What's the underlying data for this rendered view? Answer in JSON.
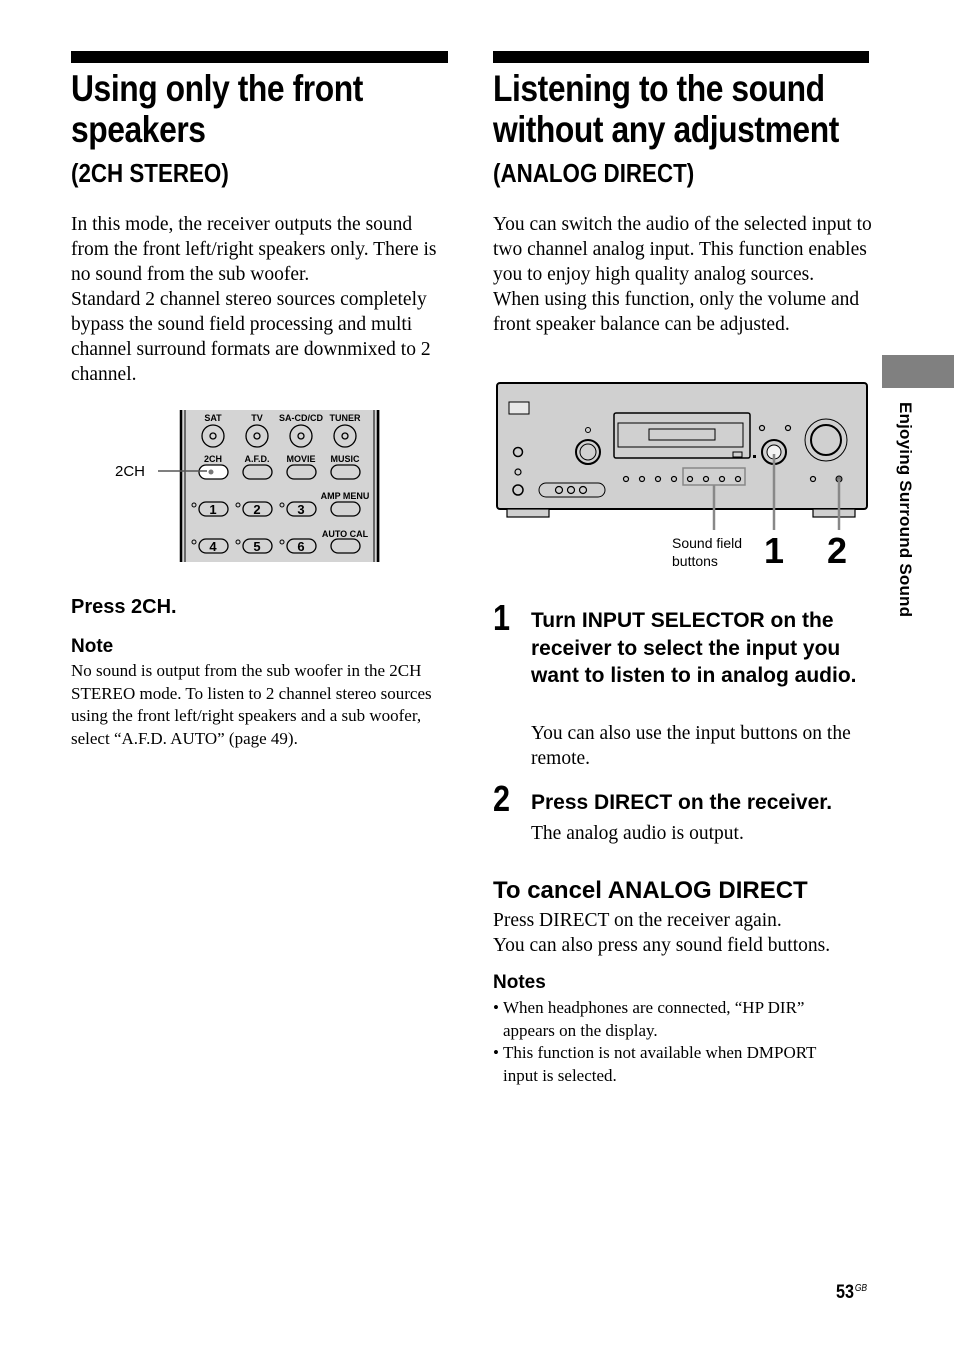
{
  "left_section": {
    "title_line1": "Using only the front",
    "title_line2": "speakers",
    "subtitle": "(2CH STEREO)",
    "paragraph1": "In this mode, the receiver outputs the sound from the front left/right speakers only. There is no sound from the sub woofer.",
    "paragraph2": "Standard 2 channel stereo sources completely bypass the sound field processing and multi channel surround formats are downmixed to 2 channel.",
    "remote_figure": {
      "callout_label": "2CH",
      "row1_labels": [
        "SAT",
        "TV",
        "SA-CD/CD",
        "TUNER"
      ],
      "row2_labels": [
        "2CH",
        "A.F.D.",
        "MOVIE",
        "MUSIC"
      ],
      "row3_numbers": [
        "1",
        "2",
        "3"
      ],
      "row3_label": "AMP MENU",
      "row4_numbers": [
        "4",
        "5",
        "6"
      ],
      "row4_label": "AUTO CAL"
    },
    "instruction": "Press 2CH.",
    "note_heading": "Note",
    "note_text": "No sound is output from the sub woofer in the 2CH STEREO mode. To listen to 2 channel stereo sources using the front left/right speakers and a sub woofer, select “A.F.D. AUTO” (page 49)."
  },
  "right_section": {
    "title_line1": "Listening to the sound",
    "title_line2": "without any adjustment",
    "subtitle": "(ANALOG DIRECT)",
    "paragraph1": "You can switch the audio of the selected input to two channel analog input. This function enables you to enjoy high quality analog sources.",
    "paragraph2": "When using this function, only the volume and front speaker balance can be adjusted.",
    "receiver_figure": {
      "callout_sound_field_line1": "Sound field",
      "callout_sound_field_line2": "buttons",
      "callout_1": "1",
      "callout_2": "2"
    },
    "steps": [
      {
        "number": "1",
        "title": "Turn INPUT SELECTOR on the receiver to select the input you want to listen to in analog audio.",
        "detail": "You can also use the input buttons on the remote."
      },
      {
        "number": "2",
        "title": "Press DIRECT on the receiver.",
        "detail": "The analog audio is output."
      }
    ],
    "cancel_heading": "To cancel ANALOG DIRECT",
    "cancel_line1": "Press DIRECT on the receiver again.",
    "cancel_line2": "You can also press any sound field buttons.",
    "notes_heading": "Notes",
    "notes": [
      "When headphones are connected, “HP DIR” appears on the display.",
      "This function is not available when DMPORT input is selected."
    ]
  },
  "side_tab": {
    "label": "Enjoying Surround Sound",
    "color": "#808080"
  },
  "footer": {
    "page_number": "53",
    "page_suffix": "GB"
  }
}
